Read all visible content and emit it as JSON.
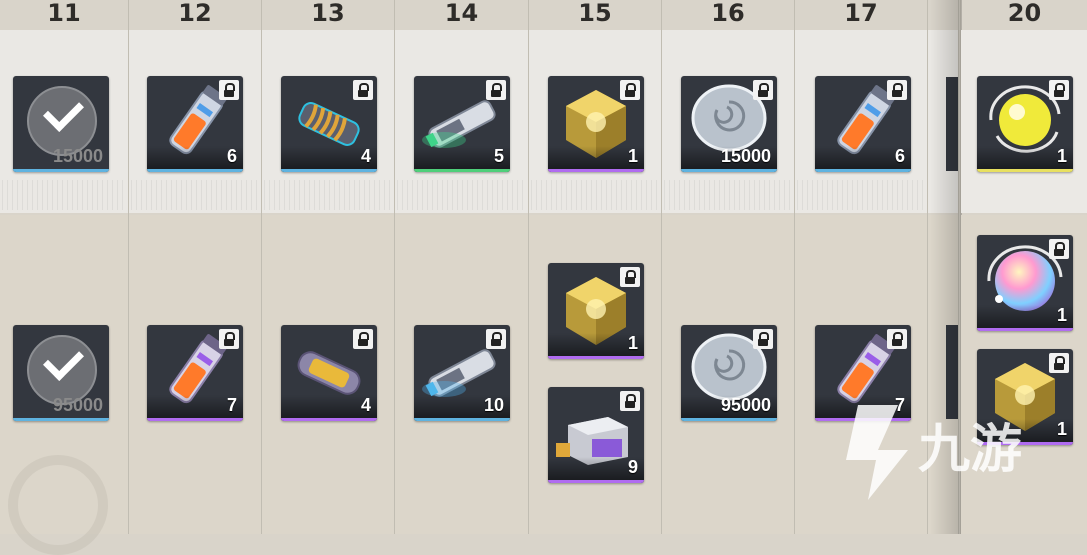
{
  "days": [
    {
      "day": "11"
    },
    {
      "day": "12"
    },
    {
      "day": "13"
    },
    {
      "day": "14"
    },
    {
      "day": "15"
    },
    {
      "day": "16"
    },
    {
      "day": "17"
    },
    {
      "day": "20"
    }
  ],
  "free_rewards": [
    {
      "name": "claimed-credits",
      "qty": "15000",
      "claimed": true
    },
    {
      "name": "exp-vial-blue",
      "qty": "6",
      "rarity": "blue"
    },
    {
      "name": "coil-component",
      "qty": "4",
      "rarity": "blue"
    },
    {
      "name": "exp-cartridge-green",
      "qty": "5",
      "rarity": "green"
    },
    {
      "name": "gold-crystal-cube",
      "qty": "1",
      "rarity": "purple"
    },
    {
      "name": "silver-coin",
      "qty": "15000",
      "rarity": "blue"
    },
    {
      "name": "exp-vial-blue",
      "qty": "6",
      "rarity": "blue"
    },
    {
      "name": "yellow-orb",
      "qty": "1",
      "rarity": "gold"
    }
  ],
  "premium_rewards": [
    {
      "name": "claimed-credits",
      "qty": "95000",
      "claimed": true
    },
    {
      "name": "exp-vial-purple",
      "qty": "7",
      "rarity": "purple"
    },
    {
      "name": "gold-capsule",
      "qty": "4",
      "rarity": "purple"
    },
    {
      "name": "exp-cartridge-blue",
      "qty": "10",
      "rarity": "blue"
    },
    {
      "name": "gold-crystal-cube",
      "qty": "1",
      "rarity": "purple"
    },
    {
      "name": "supply-crate",
      "qty": "9",
      "rarity": "purple"
    },
    {
      "name": "silver-coin",
      "qty": "95000",
      "rarity": "blue"
    },
    {
      "name": "exp-vial-purple",
      "qty": "7",
      "rarity": "purple"
    },
    {
      "name": "rainbow-orb",
      "qty": "1",
      "rarity": "purple"
    },
    {
      "name": "gold-crystal-cube",
      "qty": "1",
      "rarity": "purple"
    }
  ],
  "colors": {
    "blue": "#5fb3e0",
    "green": "#4fcf7a",
    "purple": "#b06cf0",
    "gold": "#e8e060",
    "background": "#d9d4ca"
  },
  "watermark": {
    "text": "九游"
  }
}
